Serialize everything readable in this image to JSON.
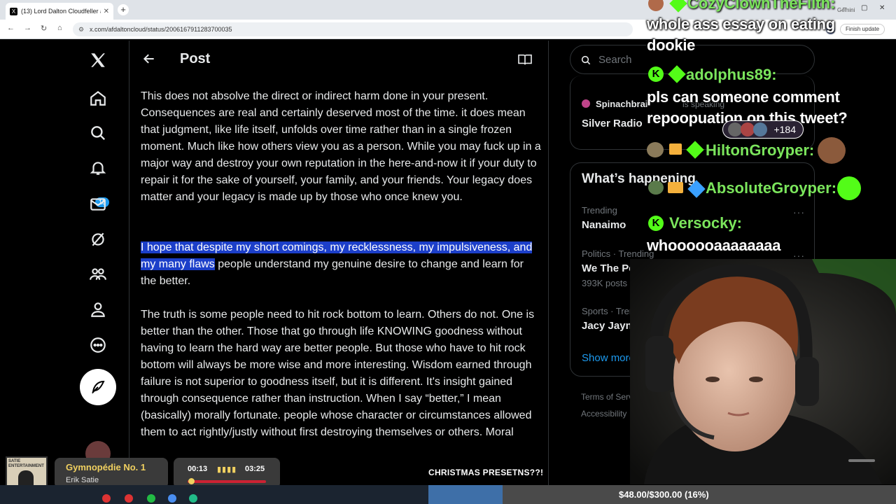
{
  "browser": {
    "tab_title": "(13) Lord Dalton Cloudfeller à on X",
    "url": "x.com/afdaltoncloud/status/2006167911283700035",
    "finish_update": "Finish update",
    "gemini": "Gemini"
  },
  "x_nav": {
    "notifications_badge": "18"
  },
  "post": {
    "header_title": "Post",
    "paragraph1": "This does not absolve the direct or indirect harm done in your present. Consequences are real and certainly deserved most of the time. it does mean that judgment, like life itself, unfolds over time rather than in a single frozen moment. Much like how others view you as a person. While you may fuck up in a major way and destroy your own reputation in the here-and-now it if your duty to repair it for the sake of yourself, your family, and your friends. Your legacy does matter and your legacy is made up by those who once knew you.",
    "paragraph2_highlight": "I hope that despite my short comings, my recklessness, my impulsiveness, and my many flaws",
    "paragraph2_rest": " people understand my genuine desire to change and learn for the better.",
    "paragraph3": "The truth is some people need to hit rock bottom to learn. Others do not. One is better than the other. Those that go through life KNOWING goodness without having to learn the hard way are better people. But those who have to hit rock bottom will always be more wise and more interesting. Wisdom earned through failure is not superior to goodness itself, but it is different. It's insight gained through consequence rather than instruction. When I say “better,” I mean (basically) morally fortunate. people whose character or circumstances allowed them to act rightly/justly without first destroying themselves or others. Moral"
  },
  "right": {
    "search_placeholder": "Search",
    "space_host": "Spinachbrai",
    "space_status": "is speaking",
    "space_title": "Silver Radio",
    "trending_header": "What’s happening",
    "trends": [
      {
        "meta": "Trending",
        "name": "Nanaimo",
        "count": ""
      },
      {
        "meta": "Politics · Trending",
        "name": "We The People",
        "count": "393K posts"
      },
      {
        "meta": "Sports · Trending",
        "name": "Jacy Jayne",
        "count": ""
      }
    ],
    "show_more": "Show more",
    "footer_terms": "Terms of Service",
    "footer_access": "Accessibility"
  },
  "chat": {
    "m1_user": "CozyClownTheFilth:",
    "m1_text_a": "whole ass essay on eating",
    "m1_text_b": "dookie",
    "m2_user": "adolphus89:",
    "m2_text_a": "pls can someone comment",
    "m2_text_b": "repoopuation on this tweet?",
    "plus_count": "+184",
    "m3_user": "HiltonGroyper:",
    "m4_user": "AbsoluteGroyper:",
    "m5_user": "Versocky:",
    "m5_text": "whoooooaaaaaaaa"
  },
  "music": {
    "title": "Gymnopédie No. 1",
    "artist": "Erik Satie",
    "current": "00:13",
    "total": "03:25",
    "progress": 0.06,
    "album_label": "SATIE ENTERTAINMENT"
  },
  "overlay": {
    "banner": "CHRISTMAS PRESETNS??!",
    "goal": "$48.00/$300.00 (16%)"
  },
  "colors": {
    "accent": "#1d9bf0",
    "highlight": "#1c3fc9",
    "kick_green": "#53fc18"
  }
}
